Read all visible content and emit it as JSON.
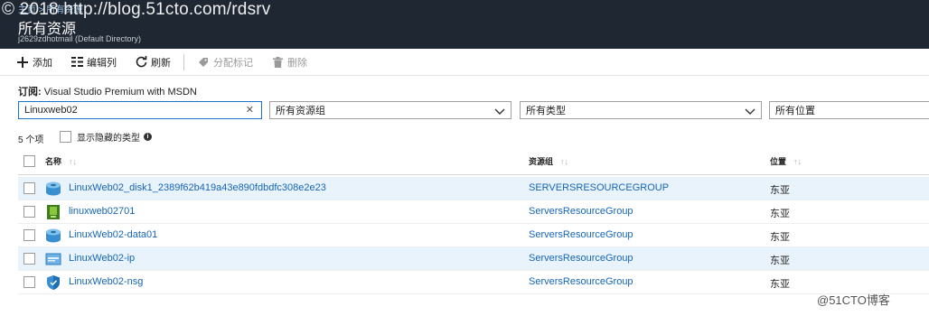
{
  "watermark": "© 2018 http://blog.51cto.com/rdsrv",
  "header": {
    "breadcrumb": "主页 > 所有资源",
    "title": "所有资源",
    "subtitle": "j2629zdhotmail (Default Directory)"
  },
  "toolbar": {
    "add_label": "添加",
    "edit_columns_label": "编辑列",
    "refresh_label": "刷新",
    "assign_tags_label": "分配标记",
    "delete_label": "删除"
  },
  "subscription": {
    "label": "订阅:",
    "value": "Visual Studio Premium with MSDN"
  },
  "filters": {
    "search_value": "Linuxweb02",
    "resource_group": "所有资源组",
    "type": "所有类型",
    "location": "所有位置"
  },
  "list": {
    "count_text": "5 个项",
    "show_hidden_label": "显示隐藏的类型"
  },
  "table": {
    "headers": {
      "name": "名称",
      "resource_group": "资源组",
      "location": "位置"
    },
    "rows": [
      {
        "name": "LinuxWeb02_disk1_2389f62b419a43e890fdbdfc308e2e23",
        "resource_group": "SERVERSRESOURCEGROUP",
        "location": "东亚",
        "icon": "disk-icon"
      },
      {
        "name": "linuxweb02701",
        "resource_group": "ServersResourceGroup",
        "location": "东亚",
        "icon": "network-interface-icon"
      },
      {
        "name": "LinuxWeb02-data01",
        "resource_group": "ServersResourceGroup",
        "location": "东亚",
        "icon": "disk-icon"
      },
      {
        "name": "LinuxWeb02-ip",
        "resource_group": "ServersResourceGroup",
        "location": "东亚",
        "icon": "public-ip-icon"
      },
      {
        "name": "LinuxWeb02-nsg",
        "resource_group": "ServersResourceGroup",
        "location": "东亚",
        "icon": "shield-icon"
      }
    ]
  },
  "footer_watermark": "@51CTO博客",
  "colors": {
    "header_bg": "#1f2733",
    "link": "#1565b8",
    "selected_row": "#e9f3fb"
  }
}
